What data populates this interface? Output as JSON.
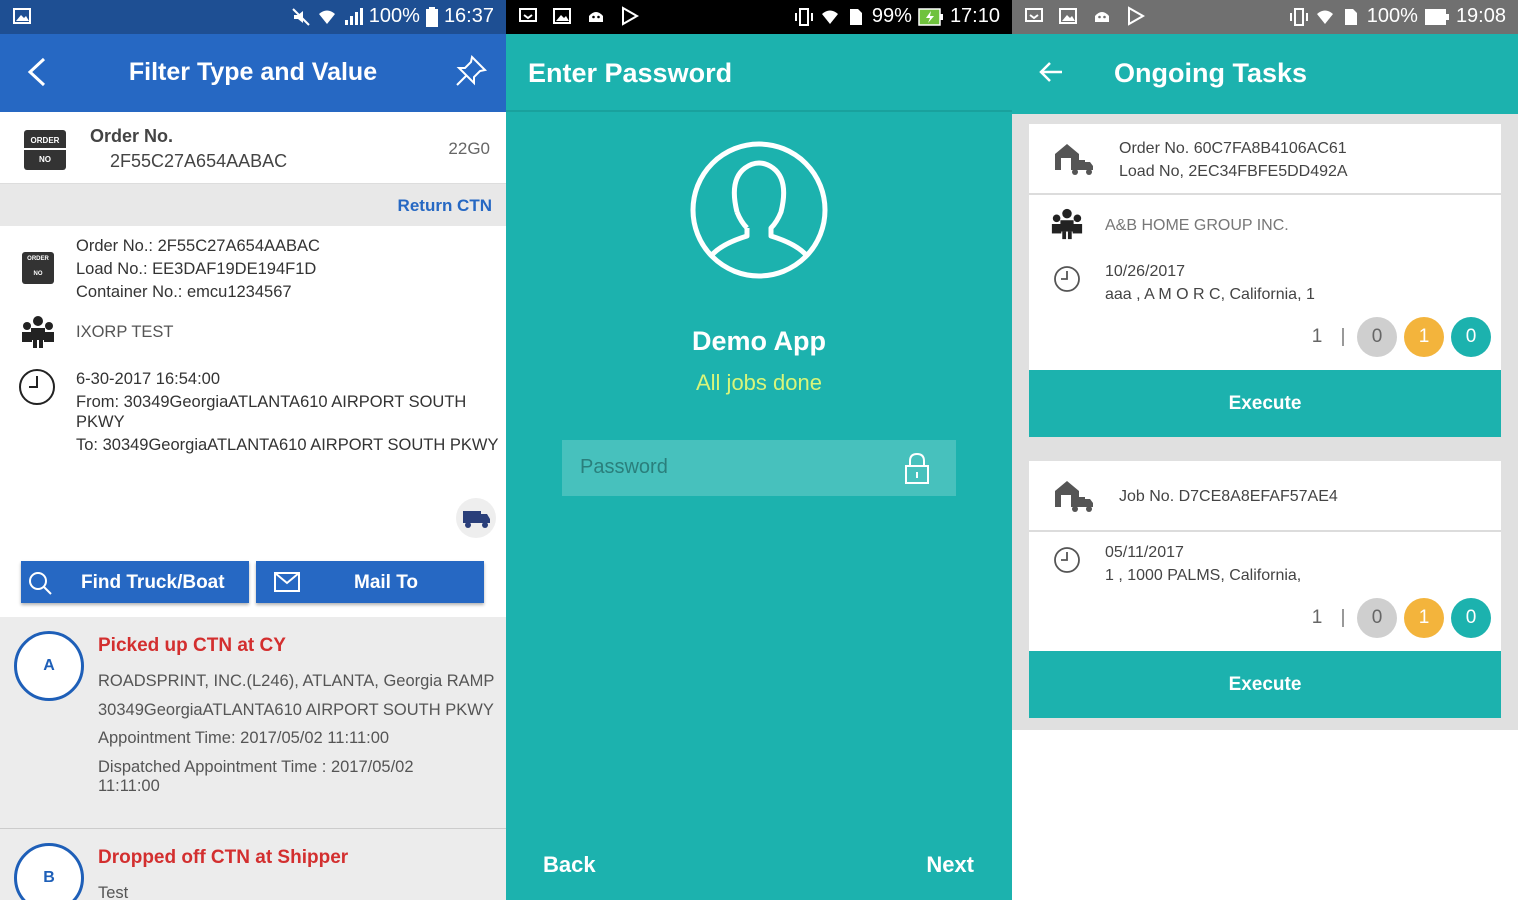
{
  "panel1": {
    "status": {
      "battery": "100%",
      "time": "16:37"
    },
    "title": "Filter Type and Value",
    "order_badge": {
      "top": "ORDER",
      "bottom": "NO"
    },
    "order_label": "Order No.",
    "order_value": "2F55C27A654AABAC",
    "order_code": "22G0",
    "return_ctn": "Return CTN",
    "details": {
      "order_no": "Order No.: 2F55C27A654AABAC",
      "load_no": "Load No.: EE3DAF19DE194F1D",
      "container_no": "Container No.: emcu1234567",
      "company": "IXORP TEST",
      "datetime": "6-30-2017 16:54:00",
      "from_line1": "From: 30349GeorgiaATLANTA610 AIRPORT SOUTH",
      "from_line2": "PKWY",
      "to": "To: 30349GeorgiaATLANTA610 AIRPORT SOUTH PKWY"
    },
    "buttons": {
      "find": "Find Truck/Boat",
      "mail": "Mail To"
    },
    "timeline": [
      {
        "marker": "A",
        "title": "Picked up CTN at CY",
        "lines": [
          "ROADSPRINT, INC.(L246), ATLANTA, Georgia RAMP",
          "30349GeorgiaATLANTA610 AIRPORT SOUTH PKWY",
          "Appointment Time: 2017/05/02 11:11:00",
          "Dispatched Appointment Time : 2017/05/02",
          "11:11:00"
        ]
      },
      {
        "marker": "B",
        "title": "Dropped off CTN at Shipper",
        "lines": [
          "Test"
        ]
      }
    ]
  },
  "panel2": {
    "status": {
      "battery": "99%",
      "time": "17:10"
    },
    "title": "Enter Password",
    "app_name": "Demo App",
    "subtitle": "All jobs done",
    "password_placeholder": "Password",
    "back": "Back",
    "next": "Next"
  },
  "panel3": {
    "status": {
      "battery": "100%",
      "time": "19:08"
    },
    "title": "Ongoing Tasks",
    "tasks": [
      {
        "head_line1": "Order No. 60C7FA8B4106AC61",
        "head_line2": "Load No, 2EC34FBFE5DD492A",
        "company": "A&B HOME GROUP INC.",
        "date": "10/26/2017",
        "address": "aaa  , A M O R C, California, 1",
        "count": "1",
        "grey": "0",
        "amber": "1",
        "teal": "0",
        "action": "Execute"
      },
      {
        "head_line1": "Job No. D7CE8A8EFAF57AE4",
        "date": "05/11/2017",
        "address": "1  , 1000 PALMS, California,",
        "count": "1",
        "grey": "0",
        "amber": "1",
        "teal": "0",
        "action": "Execute"
      }
    ]
  },
  "colors": {
    "blue_appbar": "#2668c3",
    "teal": "#1cb2ae",
    "red_title": "#d32f2f",
    "amber": "#f3b43c",
    "lime_text": "#d8f57a"
  }
}
